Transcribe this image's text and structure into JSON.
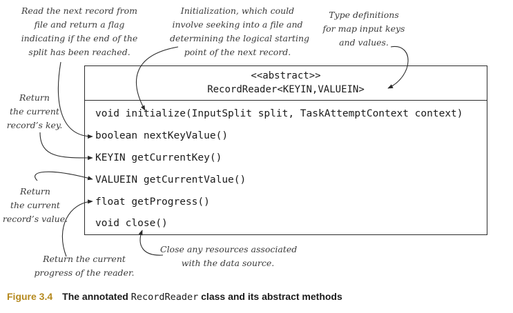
{
  "notes": {
    "next_record": [
      "Read the next record from",
      "file and return a flag",
      "indicating if the end of the",
      "split has been reached."
    ],
    "initialization": [
      "Initialization, which could",
      "involve seeking into a file and",
      "determining the logical starting",
      "point of the next record."
    ],
    "type_defs": [
      "Type definitions",
      "for map input keys",
      "and values."
    ],
    "return_key": [
      "Return",
      "the current",
      "record’s key."
    ],
    "return_value": [
      "Return",
      "the current",
      "record’s value."
    ],
    "return_progress": [
      "Return the current",
      "progress of the reader."
    ],
    "close_resources": [
      "Close any resources associated",
      "with the data source."
    ]
  },
  "class_box": {
    "stereotype": "<<abstract>>",
    "name": "RecordReader<KEYIN,VALUEIN>",
    "methods": [
      "void initialize(InputSplit split, TaskAttemptContext context)",
      "boolean nextKeyValue()",
      "KEYIN getCurrentKey()",
      "VALUEIN getCurrentValue()",
      "float getProgress()",
      "void close()"
    ]
  },
  "caption": {
    "figure_label": "Figure 3.4",
    "text_before": "The annotated ",
    "text_code": "RecordReader",
    "text_after": " class and its abstract methods"
  },
  "colors": {
    "figure_label": "#b5891e",
    "note_text": "#3a3a3a",
    "lines": "#2b2b2b"
  }
}
